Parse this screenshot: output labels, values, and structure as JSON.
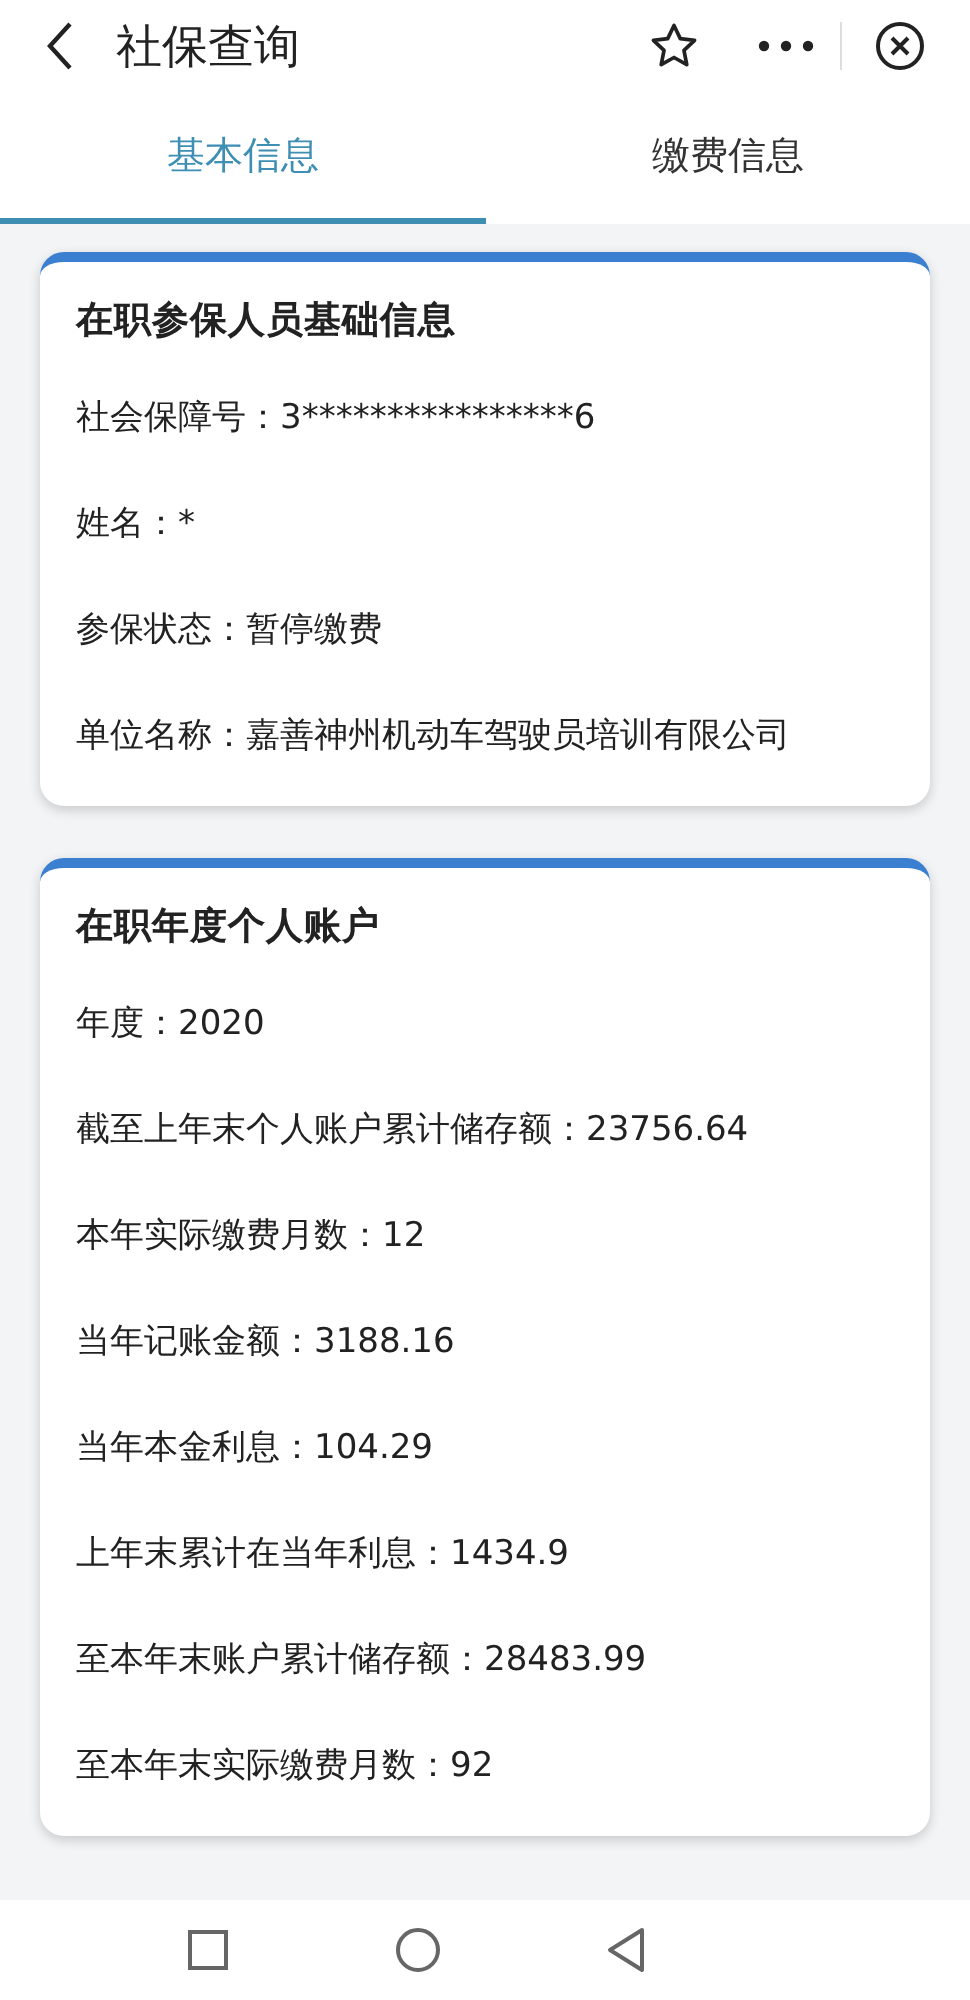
{
  "header": {
    "title": "社保查询"
  },
  "tabs": [
    {
      "label": "基本信息",
      "selected": true
    },
    {
      "label": "缴费信息",
      "selected": false
    }
  ],
  "cards": [
    {
      "title": "在职参保人员基础信息",
      "rows": [
        {
          "label": "社会保障号：",
          "value": "3****************6"
        },
        {
          "label": "姓名：",
          "value": "*"
        },
        {
          "label": "参保状态：",
          "value": "暂停缴费"
        },
        {
          "label": "单位名称：",
          "value": "嘉善神州机动车驾驶员培训有限公司"
        }
      ]
    },
    {
      "title": "在职年度个人账户",
      "rows": [
        {
          "label": "年度：",
          "value": "2020"
        },
        {
          "label": "截至上年末个人账户累计储存额：",
          "value": "23756.64"
        },
        {
          "label": "本年实际缴费月数：",
          "value": "12"
        },
        {
          "label": "当年记账金额：",
          "value": "3188.16"
        },
        {
          "label": "当年本金利息：",
          "value": "104.29"
        },
        {
          "label": "上年末累计在当年利息：",
          "value": "1434.9"
        },
        {
          "label": "至本年末账户累计储存额：",
          "value": "28483.99"
        },
        {
          "label": "至本年末实际缴费月数：",
          "value": "92"
        }
      ]
    }
  ]
}
